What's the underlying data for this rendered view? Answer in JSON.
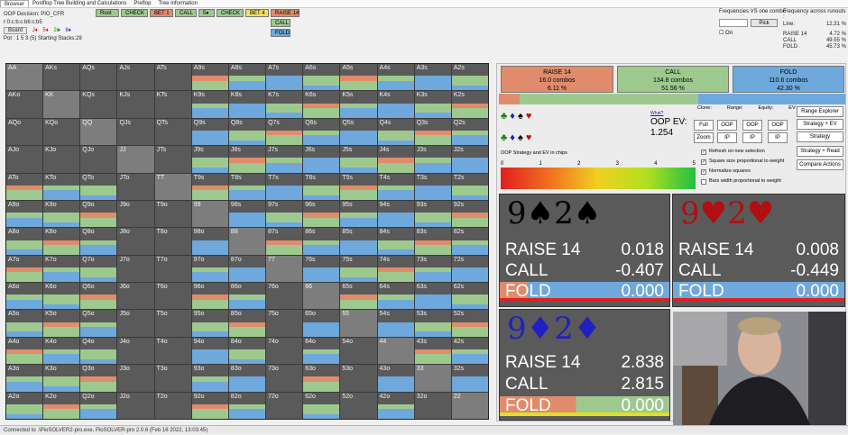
{
  "menu": [
    "Browser",
    "Postflop Tree Building and Calculations",
    "Preflop",
    "Tree information"
  ],
  "left": {
    "decision": "OOP Decision: PIO_CFR",
    "path": "r:0:c:b:c:b6:c:b5",
    "board_btn": "Board",
    "suits": [
      "J♦",
      "5♦",
      "2♣",
      "8♦"
    ],
    "pot": "Pot : 1 5 3 (5) Starting Stacks:29"
  },
  "tree": [
    {
      "label": "Root",
      "color": "#9ec98e"
    },
    {
      "label": "CHECK",
      "color": "#9ec98e"
    },
    {
      "label": "BET 1",
      "color": "#e08c6c"
    },
    {
      "label": "CALL",
      "color": "#9ec98e"
    },
    {
      "label": "5♦",
      "color": "#9ec98e"
    },
    {
      "label": "CHECK",
      "color": "#9ec98e"
    },
    {
      "label": "BET 4",
      "color": "#f0e060"
    },
    {
      "label": "RAISE 14",
      "color": "#e08c6c"
    }
  ],
  "tree_sub": [
    {
      "label": "CALL",
      "color": "#9ec98e"
    },
    {
      "label": "FOLD",
      "color": "#6fa8dc"
    }
  ],
  "freq": {
    "title": "Frequencies VS one combo",
    "pick": "Pick",
    "on": "On",
    "title2": "Frequency across runouts :",
    "line_label": "Line:",
    "line_val": "12.31 %",
    "rows": [
      {
        "k": "RAISE 14",
        "v": "4.72 %"
      },
      {
        "k": "CALL",
        "v": "49.55 %"
      },
      {
        "k": "FOLD",
        "v": "45.73 %"
      }
    ]
  },
  "hands": [
    "AA",
    "AKs",
    "AQs",
    "AJs",
    "ATs",
    "A9s",
    "A8s",
    "A7s",
    "A6s",
    "A5s",
    "A4s",
    "A3s",
    "A2s",
    "AKo",
    "KK",
    "KQs",
    "KJs",
    "KTs",
    "K9s",
    "K8s",
    "K7s",
    "K6s",
    "K5s",
    "K4s",
    "K3s",
    "K2s",
    "AQo",
    "KQo",
    "QQ",
    "QJs",
    "QTs",
    "Q9s",
    "Q8s",
    "Q7s",
    "Q6s",
    "Q5s",
    "Q4s",
    "Q3s",
    "Q2s",
    "AJo",
    "KJo",
    "QJo",
    "JJ",
    "JTs",
    "J9s",
    "J8s",
    "J7s",
    "J6s",
    "J5s",
    "J4s",
    "J3s",
    "J2s",
    "ATo",
    "KTo",
    "QTo",
    "JTo",
    "TT",
    "T9s",
    "T8s",
    "T7s",
    "T6s",
    "T5s",
    "T4s",
    "T3s",
    "T2s",
    "A9o",
    "K9o",
    "Q9o",
    "J9o",
    "T9o",
    "99",
    "98s",
    "97s",
    "96s",
    "95s",
    "94s",
    "93s",
    "92s",
    "A8o",
    "K8o",
    "Q8o",
    "J8o",
    "T8o",
    "98o",
    "88",
    "87s",
    "86s",
    "85s",
    "84s",
    "83s",
    "82s",
    "A7o",
    "K7o",
    "Q7o",
    "J7o",
    "T7o",
    "97o",
    "87o",
    "77",
    "76s",
    "75s",
    "74s",
    "73s",
    "72s",
    "A6o",
    "K6o",
    "Q6o",
    "J6o",
    "T6o",
    "96o",
    "86o",
    "76o",
    "66",
    "65s",
    "64s",
    "63s",
    "62s",
    "A5o",
    "K5o",
    "Q5o",
    "J5o",
    "T5o",
    "95o",
    "85o",
    "75o",
    "65o",
    "55",
    "54s",
    "53s",
    "52s",
    "A4o",
    "K4o",
    "Q4o",
    "J4o",
    "T4o",
    "94o",
    "84o",
    "74o",
    "64o",
    "54o",
    "44",
    "43s",
    "42s",
    "A3o",
    "K3o",
    "Q3o",
    "J3o",
    "T3o",
    "93o",
    "83o",
    "73o",
    "63o",
    "53o",
    "43o",
    "33",
    "32s",
    "A2o",
    "K2o",
    "Q2o",
    "J2o",
    "T2o",
    "92o",
    "82o",
    "72o",
    "62o",
    "52o",
    "42o",
    "32o",
    "22"
  ],
  "actions": [
    {
      "label": "RAISE 14",
      "combos": "16.0 combos",
      "pct": "6.11 %",
      "color": "#e08c6c"
    },
    {
      "label": "CALL",
      "combos": "134.8 combos",
      "pct": "51.56 %",
      "color": "#9ec98e"
    },
    {
      "label": "FOLD",
      "combos": "110.6 combos",
      "pct": "42.30 %",
      "color": "#6fa8dc"
    }
  ],
  "strategy_share": [
    {
      "color": "#e08c6c",
      "v": 6.11
    },
    {
      "color": "#9ec98e",
      "v": 51.56
    },
    {
      "color": "#6fa8dc",
      "v": 42.3
    }
  ],
  "ev": {
    "what": "What?",
    "label": "OOP EV:",
    "value": "1.254"
  },
  "controls": {
    "clone": "Clone:",
    "range": "Range:",
    "equity": "Equity:",
    "evl": "EV:",
    "full": "Full",
    "zoom": "Zoom",
    "oop": "OOP",
    "ip": "IP",
    "range_explorer": "Range Explorer",
    "strategy_ev": "Strategy + EV",
    "strategy": "Strategy",
    "strategy_read": "Strategy + Read",
    "compare": "Compare Actions"
  },
  "scale": {
    "title": "OOP Strategy and EV in chips",
    "ticks": [
      "0",
      "1",
      "2",
      "3",
      "4",
      "5"
    ]
  },
  "checks": [
    "Refresh on new selection",
    "Square size proportional to weight",
    "Normalize squares",
    "Bars width proportional to weight"
  ],
  "combos": [
    {
      "cards": "9♠2♠",
      "suit_color": "#000000",
      "raise": "0.018",
      "call": "-0.407",
      "fold": "0.000"
    },
    {
      "cards": "9♥2♥",
      "suit_color": "#b01010",
      "raise": "0.008",
      "call": "-0.449",
      "fold": "0.000"
    },
    {
      "cards": "9♦2♦",
      "suit_color": "#2020c0",
      "raise": "2.838",
      "call": "2.815",
      "fold": "0.000"
    }
  ],
  "row_labels": {
    "raise": "RAISE 14",
    "call": "CALL",
    "fold": "FOLD"
  },
  "status": "Connected to .\\PioSOLVER2-pro.exe, PioSOLVER-pro 2.0.6 (Feb 16 2022, 13:03:45)"
}
